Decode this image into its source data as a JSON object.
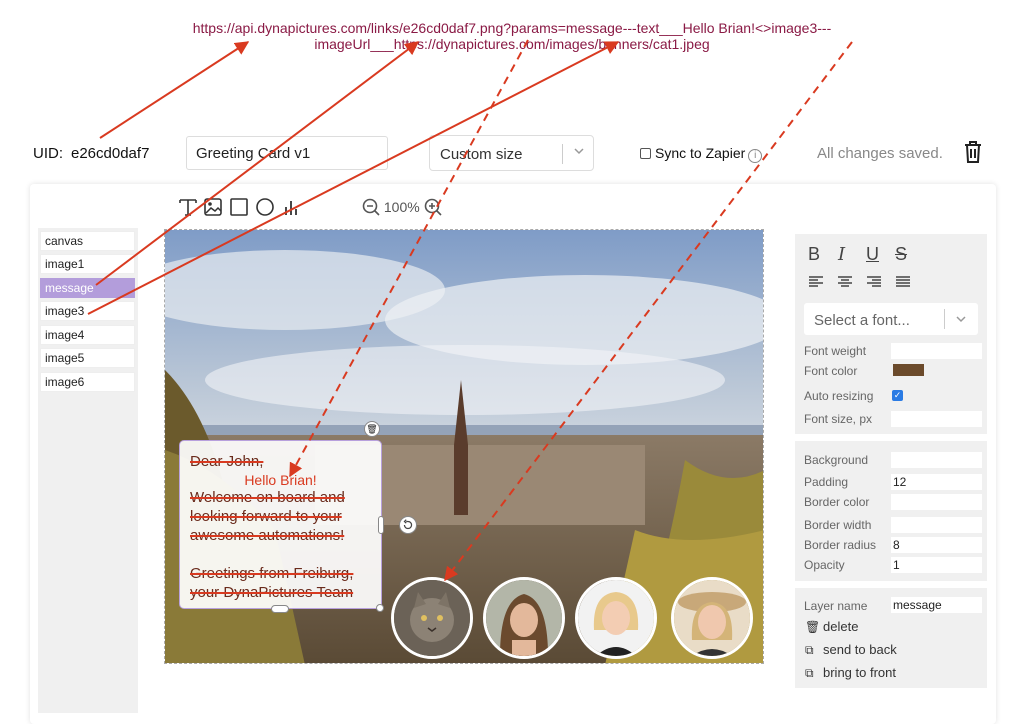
{
  "url_annotation": "https://api.dynapictures.com/links/e26cd0daf7.png?params=message---text___Hello Brian!<>image3---imageUrl___https://dynapictures.com/images/banners/cat1.jpeg",
  "header": {
    "uid_label": "UID:",
    "uid_value": "e26cd0daf7",
    "title_value": "Greeting Card v1",
    "size_value": "Custom size",
    "sync_label": "Sync to Zapier",
    "saved_status": "All changes saved."
  },
  "toolbar": {
    "zoom_level": "100%"
  },
  "layers": [
    "canvas",
    "image1",
    "message",
    "image3",
    "image4",
    "image5",
    "image6"
  ],
  "active_layer": "message",
  "message_box": {
    "line1": "Dear John,",
    "replacement": "Hello Brian!",
    "line2": "Welcome on board and",
    "line3": "looking forward to your",
    "line4": "awesome automations!",
    "line5": "Greetings from Freiburg,",
    "line6": "your DynaPictures Team"
  },
  "properties": {
    "font_placeholder": "Select a font...",
    "font_weight_label": "Font weight",
    "font_color_label": "Font color",
    "auto_resizing_label": "Auto resizing",
    "font_size_label": "Font size, px",
    "background_label": "Background",
    "padding_label": "Padding",
    "padding_value": "12",
    "border_color_label": "Border color",
    "border_width_label": "Border width",
    "border_radius_label": "Border radius",
    "border_radius_value": "8",
    "opacity_label": "Opacity",
    "opacity_value": "1",
    "layer_name_label": "Layer name",
    "layer_name_value": "message",
    "delete_label": "delete",
    "send_back_label": "send to back",
    "bring_front_label": "bring to front"
  },
  "colors": {
    "accent": "#b39ddb",
    "font_color": "#6b4a2b",
    "annotation": "#d93a20",
    "url_text": "#8a1a45"
  }
}
